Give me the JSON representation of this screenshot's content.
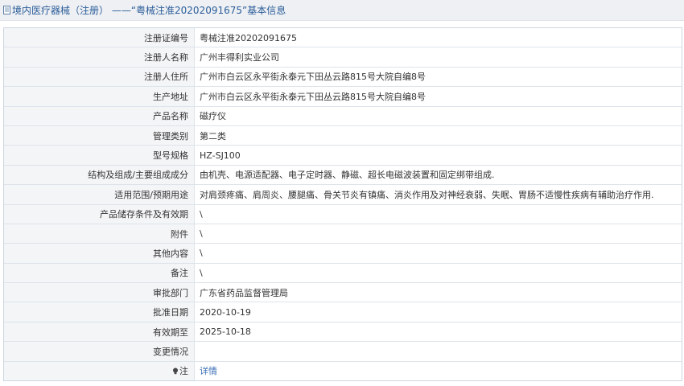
{
  "header": {
    "title": "境内医疗器械（注册） ——“粤械注准20202091675”基本信息"
  },
  "rows": [
    {
      "label": "注册证编号",
      "value": "粤械注准20202091675"
    },
    {
      "label": "注册人名称",
      "value": "广州丰得利实业公司"
    },
    {
      "label": "注册人住所",
      "value": "广州市白云区永平街永泰元下田丛云路815号大院自编8号"
    },
    {
      "label": "生产地址",
      "value": "广州市白云区永平街永泰元下田丛云路815号大院自编8号"
    },
    {
      "label": "产品名称",
      "value": "磁疗仪"
    },
    {
      "label": "管理类别",
      "value": "第二类"
    },
    {
      "label": "型号规格",
      "value": "HZ-SJ100"
    },
    {
      "label": "结构及组成/主要组成成分",
      "value": "由机壳、电源适配器、电子定时器、静磁、超长电磁波装置和固定绑带组成."
    },
    {
      "label": "适用范围/预期用途",
      "value": "对肩颈疼痛、肩周炎、腰腿痛、骨关节炎有镇痛、消炎作用及对神经衰弱、失眠、胃肠不适慢性疾病有辅助治疗作用."
    },
    {
      "label": "产品储存条件及有效期",
      "value": "\\"
    },
    {
      "label": "附件",
      "value": "\\"
    },
    {
      "label": "其他内容",
      "value": "\\"
    },
    {
      "label": "备注",
      "value": "\\"
    },
    {
      "label": "审批部门",
      "value": "广东省药品监督管理局"
    },
    {
      "label": "批准日期",
      "value": "2020-10-19"
    },
    {
      "label": "有效期至",
      "value": "2025-10-18"
    },
    {
      "label": "变更情况",
      "value": ""
    }
  ],
  "note_row": {
    "label": "注",
    "link": "详情",
    "icon": "lightbulb-icon"
  }
}
